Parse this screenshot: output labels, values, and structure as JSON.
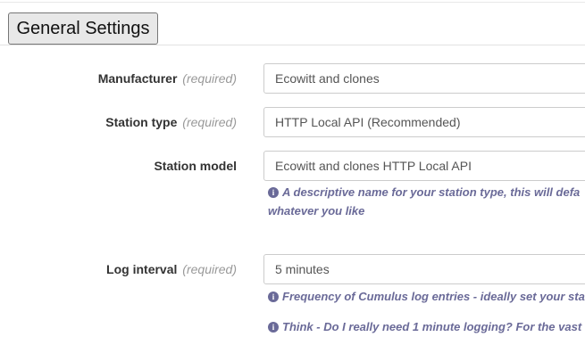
{
  "section": {
    "title": "General Settings"
  },
  "fields": {
    "manufacturer": {
      "label": "Manufacturer",
      "required": "(required)",
      "value": "Ecowitt and clones"
    },
    "station_type": {
      "label": "Station type",
      "required": "(required)",
      "value": "HTTP Local API (Recommended)"
    },
    "station_model": {
      "label": "Station model",
      "value": "Ecowitt and clones HTTP Local API",
      "help_line1": "A descriptive name for your station type, this will defa",
      "help_line2": "whatever you like"
    },
    "log_interval": {
      "label": "Log interval",
      "required": "(required)",
      "value": "5 minutes",
      "help1": "Frequency of Cumulus log entries - ideally set your sta",
      "help2": "Think - Do I really need 1 minute logging? For the vast"
    }
  },
  "icons": {
    "info": "info-circle-icon"
  },
  "colors": {
    "help_text": "#6a6a98",
    "required_text": "#999999",
    "field_border": "#cccccc"
  }
}
